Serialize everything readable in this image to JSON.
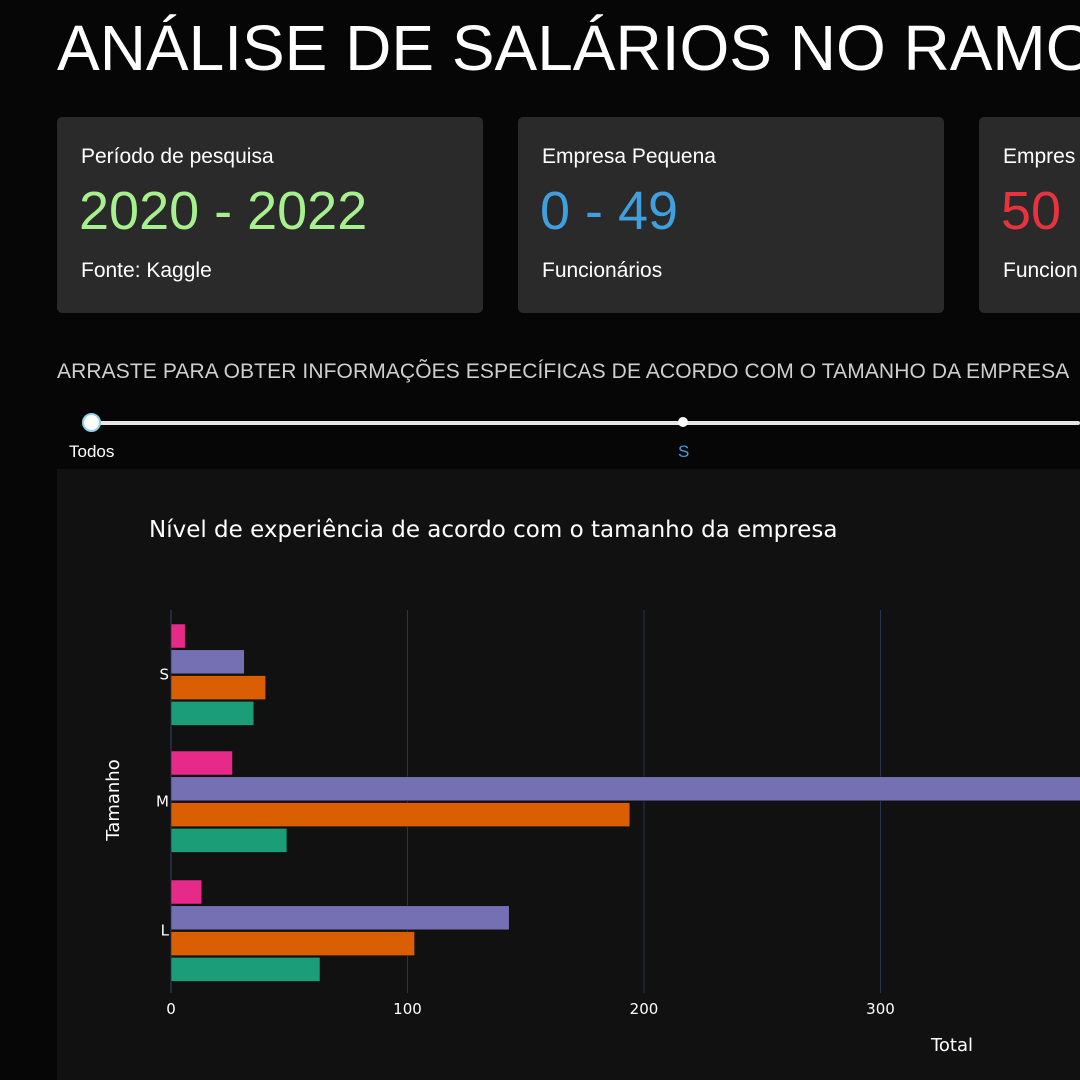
{
  "header": {
    "title": "ANÁLISE DE SALÁRIOS NO RAMO"
  },
  "cards": [
    {
      "label": "Período de pesquisa",
      "value": "2020 - 2022",
      "value_color": "#a6f08e",
      "footer": "Fonte: Kaggle"
    },
    {
      "label": "Empresa Pequena",
      "value": "0 - 49",
      "value_color": "#3fa0dd",
      "footer": "Funcionários"
    },
    {
      "label": "Empres",
      "value": "50",
      "value_color": "#e8323e",
      "footer": "Funcion"
    }
  ],
  "slider": {
    "instruction": "ARRASTE PARA OBTER INFORMAÇÕES ESPECÍFICAS DE ACORDO COM O TAMANHO DA EMPRESA",
    "marks": [
      {
        "label": "Todos",
        "color": "#ffffff"
      },
      {
        "label": "S",
        "color": "#3fa0dd"
      }
    ],
    "selected": "Todos"
  },
  "chart_data": {
    "type": "bar",
    "orientation": "horizontal",
    "title": "Nível de experiência de acordo com o tamanho da empresa",
    "xlabel": "Total",
    "ylabel": "Tamanho",
    "categories": [
      "S",
      "M",
      "L"
    ],
    "x_ticks": [
      0,
      100,
      200,
      300
    ],
    "xlim": [
      0,
      385
    ],
    "grid": true,
    "series": [
      {
        "color": "#e7298a",
        "values": [
          6,
          26,
          13
        ]
      },
      {
        "color": "#7570b3",
        "values": [
          31,
          390,
          143
        ]
      },
      {
        "color": "#d95f02",
        "values": [
          40,
          194,
          103
        ]
      },
      {
        "color": "#1b9e77",
        "values": [
          35,
          49,
          63
        ]
      }
    ]
  }
}
